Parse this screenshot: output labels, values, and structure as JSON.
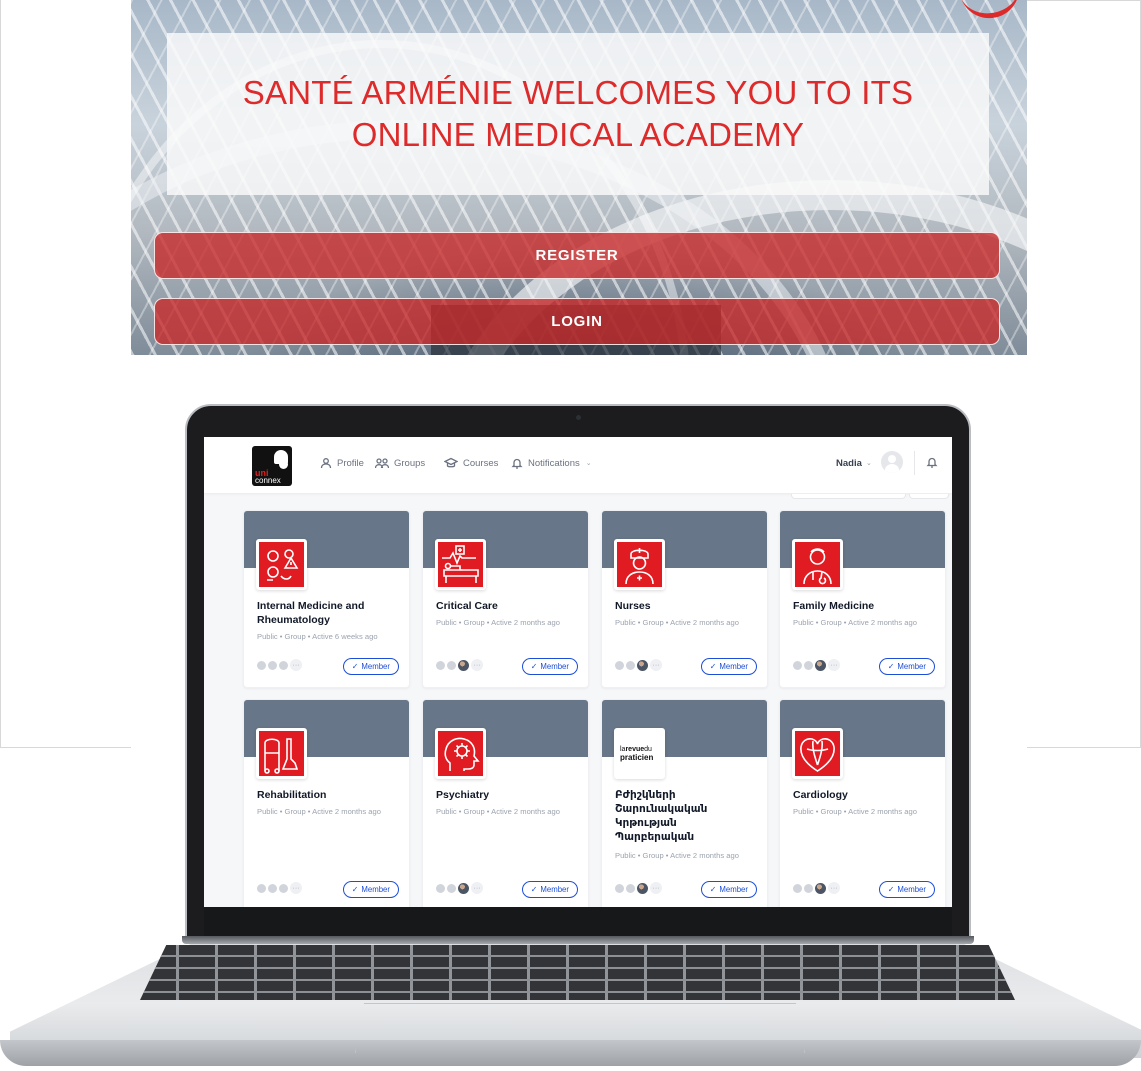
{
  "hero": {
    "welcome": "SANTÉ ARMÉNIE WELCOMES YOU TO ITS ONLINE MEDICAL ACADEMY",
    "register": "REGISTER",
    "login": "LOGIN"
  },
  "app": {
    "logo": {
      "line1": "uni",
      "line2": "connex"
    },
    "nav": {
      "profile": "Profile",
      "groups": "Groups",
      "courses": "Courses",
      "notifications": "Notifications"
    },
    "user": {
      "name": "Nadia"
    }
  },
  "cards": [
    {
      "title": "Internal Medicine and Rheumatology",
      "meta": "Public  •  Group  •  Active 6 weeks ago",
      "icon": "rheumatology-icon",
      "button": "Member"
    },
    {
      "title": "Critical Care",
      "meta": "Public  •  Group  •  Active 2 months ago",
      "icon": "hospital-bed-icon",
      "button": "Member"
    },
    {
      "title": "Nurses",
      "meta": "Public  •  Group  •  Active 2 months ago",
      "icon": "nurse-icon",
      "button": "Member"
    },
    {
      "title": "Family Medicine",
      "meta": "Public  •  Group  •  Active 2 months ago",
      "icon": "doctor-icon",
      "button": "Member"
    },
    {
      "title": "Rehabilitation",
      "meta": "Public  •  Group  •  Active 2 months ago",
      "icon": "walker-icon",
      "button": "Member"
    },
    {
      "title": "Psychiatry",
      "meta": "Public  •  Group  •  Active 2 months ago",
      "icon": "brain-gear-icon",
      "button": "Member"
    },
    {
      "title": "Բժիշկների Շարունակական Կրթության Պարբերական",
      "meta": "Public  •  Group  •  Active 2 months ago",
      "icon": "revue-logo",
      "button": "Member",
      "logo_text": {
        "la": "la",
        "revue": "revue",
        "du": "du",
        "praticien": "praticien"
      }
    },
    {
      "title": "Cardiology",
      "meta": "Public  •  Group  •  Active 2 months ago",
      "icon": "heart-icon",
      "button": "Member"
    }
  ],
  "colors": {
    "brand_red": "#dd2a2a",
    "cover_slate": "#677688",
    "member_blue": "#1d4ed8"
  }
}
